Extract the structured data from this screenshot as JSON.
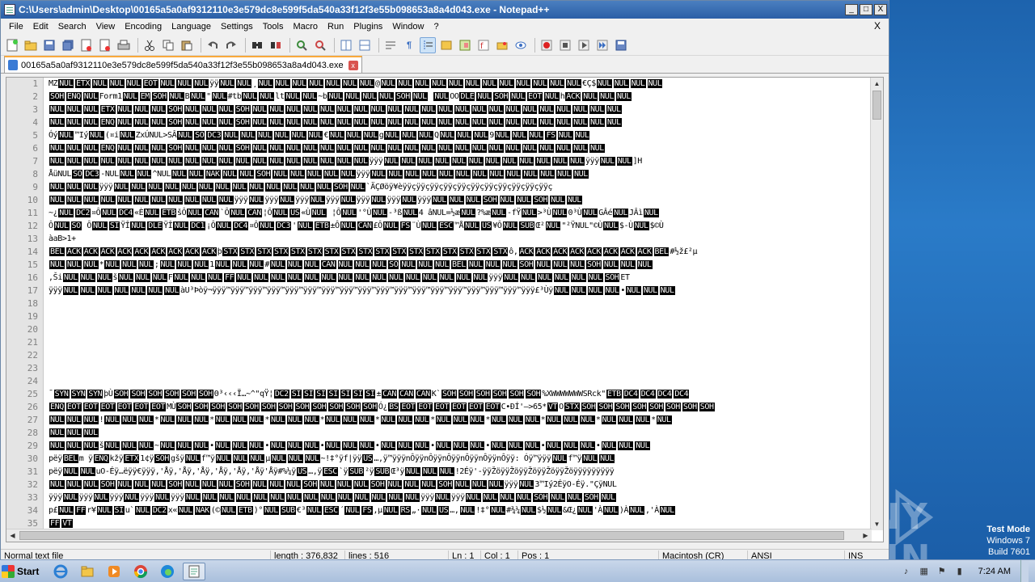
{
  "window": {
    "title": "C:\\Users\\admin\\Desktop\\00165a5a0af9312110e3e579dc8e599f5da540a33f12f3e55b098653a8a4d043.exe - Notepad++",
    "minimize": "_",
    "maximize": "□",
    "close": "X"
  },
  "menu": {
    "items": [
      "File",
      "Edit",
      "Search",
      "View",
      "Encoding",
      "Language",
      "Settings",
      "Tools",
      "Macro",
      "Run",
      "Plugins",
      "Window",
      "?"
    ],
    "close_doc": "X"
  },
  "tab": {
    "label": "00165a5a0af9312110e3e579dc8e599f5da540a33f12f3e55b098653a8a4d043.exe",
    "close": "x"
  },
  "editor": {
    "line_numbers": [
      "1",
      "2",
      "3",
      "4",
      "5",
      "6",
      "7",
      "8",
      "9",
      "10",
      "11",
      "12",
      "13",
      "14",
      "15",
      "16",
      "17",
      "18",
      "19",
      "20",
      "21",
      "22",
      "23",
      "24",
      "25",
      "26",
      "27",
      "28",
      "29",
      "30",
      "31",
      "32",
      "33",
      "34",
      "35"
    ],
    "lines": [
      [
        "MZ",
        "NUL",
        "ETX",
        "NUL",
        "NUL",
        "NUL",
        "EOT",
        "NUL",
        "NUL",
        "NUL",
        "ÿÿ",
        "NUL",
        "NUL",
        "¸",
        "NUL",
        "NUL",
        "NUL",
        "NUL",
        "NUL",
        "NUL",
        "NUL",
        "@",
        "NUL",
        "NUL",
        "NUL",
        "NUL",
        "NUL",
        "NUL",
        "NUL",
        "NUL",
        "NUL",
        "NUL",
        "NUL",
        "NUL",
        "€Ç$",
        "NUL",
        "NUL",
        "NUL",
        "NUL"
      ],
      [
        "SOH",
        "ENQ",
        "NUL",
        "Form1",
        "NUL",
        "EM",
        "SOH",
        "NUL",
        "B",
        "NUL",
        "\"",
        "NUL",
        "#tb",
        "NUL",
        "NUL",
        "lt",
        "NUL",
        "NUL",
        "~b",
        "NUL",
        "NUL",
        "NUL",
        "NUL",
        "SOH",
        "NUL",
        "   ",
        "NUL",
        "OO",
        "DLE",
        "NUL",
        "SOH",
        "NUL",
        "EOT",
        "NUL",
        "h",
        "ACK",
        "NUL",
        "NUL",
        "NUL"
      ],
      [
        "NUL",
        "NUL",
        "NUL",
        "ETX",
        "NUL",
        "NUL",
        "NUL",
        "SOH",
        "NUL",
        "NUL",
        "NUL",
        "SOH",
        "NUL",
        "NUL",
        "NUL",
        "NUL",
        "NUL",
        "NUL",
        "NUL",
        "NUL",
        "NUL",
        "NUL",
        "NUL",
        "NUL",
        "NUL",
        "NUL",
        "NUL",
        "NUL",
        "NUL",
        "NUL",
        "NUL",
        "NUL",
        "NUL",
        "NUL"
      ],
      [
        "NUL",
        "NUL",
        "NUL",
        "ENQ",
        "NUL",
        "NUL",
        "NUL",
        "SOH",
        "NUL",
        "NUL",
        "NUL",
        "SOH",
        "NUL",
        "NUL",
        "NUL",
        "NUL",
        "NUL",
        "NUL",
        "NUL",
        "NUL",
        "NUL",
        "NUL",
        "NUL",
        "NUL",
        "NUL",
        "NUL",
        "NUL",
        "NUL",
        "NUL",
        "NUL",
        "NUL",
        "NUL",
        "NUL",
        "NUL"
      ],
      [
        " Óý",
        "NUL",
        "™Iý",
        "NUL",
        "(¤i",
        "NUL",
        "Zx",
        "ÚNUL",
        ">SÂ",
        "NUL",
        "SO",
        "DC3",
        "NUL",
        "NUL",
        "NUL",
        "NUL",
        "NUL",
        "NUL",
        "€",
        "NUL",
        "NUL",
        "NUL",
        "g",
        "NUL",
        "NUL",
        "NUL",
        "Q",
        "NUL",
        "NUL",
        "NUL",
        "9",
        "NUL",
        "NUL",
        "NUL",
        "FS",
        "NUL",
        "NUL"
      ],
      [
        "NUL",
        "NUL",
        "NUL",
        "ENQ",
        "NUL",
        "NUL",
        "NUL",
        "SOH",
        "NUL",
        "NUL",
        "NUL",
        "SOH",
        "NUL",
        "NUL",
        "NUL",
        "NUL",
        "NUL",
        "NUL",
        "NUL",
        "NUL",
        "NUL",
        "NUL",
        "NUL",
        "NUL",
        "NUL",
        "NUL",
        "NUL",
        "NUL",
        "NUL",
        "NUL",
        "NUL",
        "NUL",
        "NUL"
      ],
      [
        "NUL",
        "NUL",
        "NUL",
        "NUL",
        "NUL",
        "NUL",
        "NUL",
        "NUL",
        "NUL",
        "NUL",
        "NUL",
        "NUL",
        "NUL",
        "NUL",
        "NUL",
        "NUL",
        "NUL",
        "NUL",
        "NUL",
        "ÿÿÿ",
        "NUL",
        "NUL",
        "NUL",
        "NUL",
        "NUL",
        "NUL",
        "NUL",
        "NUL",
        "NUL",
        "NUL",
        "NUL",
        "NUL",
        "ÿÿÿ",
        "NUL",
        "NUL",
        "]H"
      ],
      [
        "ÅüNUL",
        "SO",
        "DC3",
        "-NUL",
        "NUL",
        "NUL",
        "^NUL",
        "NUL",
        "NUL",
        "NAK",
        "NUL",
        "NUL",
        "SOH",
        "NUL",
        "NUL",
        "NUL",
        "NUL",
        "NUL",
        "ÿÿÿ",
        "NUL",
        "NUL",
        "NUL",
        "NUL",
        "NUL",
        "NUL",
        "NUL",
        "NUL",
        "NUL",
        "NUL",
        "NUL",
        "NUL",
        "NUL"
      ],
      [
        "NUL",
        "NUL",
        "NUL",
        "ÿÿÿ",
        "NUL",
        "NUL",
        "NUL",
        "NUL",
        "NUL",
        "NUL",
        "NUL",
        "NUL",
        "NUL",
        "NUL",
        "NUL",
        "NUL",
        "NUL",
        "SOH",
        "NUL",
        "`ÄÇØöÿ¥èÿÿçÿÿçÿÿçÿÿçÿÿçÿÿçÿÿçÿÿçÿÿçÿÿçÿÿç"
      ],
      [
        "NUL",
        "NUL",
        "NUL",
        "NUL",
        "NUL",
        "NUL",
        "NUL",
        "NUL",
        "NUL",
        "NUL",
        "NUL",
        "ÿÿÿ",
        "NUL",
        "ÿÿÿ",
        "NUL",
        "ÿÿÿ",
        "NUL",
        "ÿÿÿ",
        "NUL",
        "ÿÿÿ",
        "NUL",
        "ÿÿÿ",
        "NUL",
        "ÿÿÿ",
        "NUL",
        "NUL",
        "NUL",
        "SOH",
        "NUL",
        "NUL",
        "SOH",
        "NUL",
        "NUL"
      ],
      [
        "~¿",
        "NUL",
        "DC2",
        "¤Ô",
        "NUL",
        "DC4",
        "«È",
        "NUL",
        "ETB",
        "šÔ",
        "NUL",
        "CAN",
        "`Ô",
        "NUL",
        "CAN",
        "¦Ô",
        "NUL",
        "US",
        "«Ù",
        "NUL",
        " ¦Ô",
        "NUL",
        "'°Ù",
        "NUL",
        "-³ß",
        "NUL",
        "4 âNUL",
        "=½æ",
        "NUL",
        "?%æ",
        "NUL",
        "-fŸ",
        "NUL",
        ">³Ù",
        "NUL",
        "0³Ù",
        "NUL",
        "GÂé",
        "NUL",
        "JÂì",
        "NUL"
      ],
      [
        " Ô",
        "NUL",
        "SO",
        " Ô",
        "NUL",
        "SI",
        "ŸÎ",
        "NUL",
        "DLE",
        "ŸÎ",
        "NUL",
        "DC1",
        "¡Ô",
        "NUL",
        "DC4",
        "¤Ô",
        "NUL",
        "DC3",
        "'",
        "NUL",
        "ETB",
        "±Ô",
        "NUL",
        "CAN",
        "£Ô",
        "NUL",
        "FS",
        "¨Ù",
        "NUL",
        "ESC",
        "™Å",
        "NUL",
        "US",
        "¥Ô",
        "NUL",
        "SUB",
        "Œ²",
        "NUL",
        "\"²",
        "ŸNUL",
        "\"©Ù",
        "NUL",
        "$-Ù",
        "NUL",
        "$©Ù"
      ],
      [
        "àaB>1+"
      ],
      [
        "BEL",
        "ACK",
        "ACK",
        "ACK",
        "ACK",
        "ACK",
        "ACK",
        "ACK",
        "ACK",
        "ACK",
        "þ",
        "STX",
        "STX",
        "STX",
        "STX",
        "STX",
        "STX",
        "STX",
        "STX",
        "STX",
        "STX",
        "STX",
        "STX",
        "STX",
        "STX",
        "STX",
        "STX",
        "STX",
        "ô,",
        "ACK",
        "ACK",
        "ACK",
        "ACK",
        "ACK",
        "ACK",
        "ACK",
        "ACK",
        "BEL",
        "#½ž£²µ"
      ],
      [
        "NUL",
        "NUL",
        "NUL",
        "*",
        "NUL",
        "NUL",
        "NUL",
        ";",
        "NUL",
        "NUL",
        "NUL",
        "1",
        "NUL",
        "NUL",
        "NUL",
        "#",
        "NUL",
        "NUL",
        "NUL",
        "CAN",
        "NUL",
        "NUL",
        "NUL",
        "SO",
        "NUL",
        "NUL",
        "NUL",
        "BEL",
        "NUL",
        "NUL",
        "NUL",
        "SOH",
        "NUL",
        "NUL",
        "NUL",
        "SOH",
        "NUL",
        "NUL",
        "NUL"
      ],
      [
        ",Ši",
        "NUL",
        "NUL",
        "NUL",
        "š",
        "NUL",
        "NUL",
        "NUL",
        "F",
        "NUL",
        "NUL",
        "NUL",
        "FF",
        "NUL",
        "NUL",
        "NUL",
        "NUL",
        "NUL",
        "NUL",
        "NUL",
        "NUL",
        "NUL",
        "NUL",
        "NUL",
        "NUL",
        "NUL",
        "NUL",
        "NUL",
        "ÿÿÿ",
        "NUL",
        "NUL",
        "NUL",
        "NUL",
        "NUL",
        "NUL",
        "SOH",
        "ET"
      ],
      [
        "ÿÿÿ",
        "NUL",
        "NUL",
        "NUL",
        "NUL",
        "NUL",
        "NUL",
        "NUL",
        "àU³Þòÿ¬ÿÿÿ™ÿÿÿ™ÿÿÿ™ÿÿÿ™ÿÿÿ™ÿÿÿ™ÿÿÿ™ÿÿÿ™ÿÿÿ™ÿÿÿ™ÿÿÿ™ÿÿÿ™ÿÿÿ™ÿÿÿ™ÿÿÿ™ÿÿÿ™ÿÿÿ™ÿÿÿ£³Ùÿ",
        "NUL",
        "NUL",
        "NUL",
        "NUL",
        "•",
        "NUL",
        "NUL",
        "NUL"
      ],
      [],
      [],
      [],
      [],
      [],
      [],
      [],
      [
        "¯",
        "SYN",
        "SYN",
        "SYN",
        "þÙ",
        "SOH",
        "SOH",
        "SOH",
        "SOH",
        "SOH",
        "SOH",
        "Θ³‹‹‹Ï…~^\"qŸ¦",
        "DC2",
        "SI",
        "SI",
        "SI",
        "SI",
        "SI",
        "SI",
        "SI",
        "±",
        "CAN",
        "CAN",
        "CAN",
        "K`",
        "SOH",
        "SOH",
        "SOH",
        "SOH",
        "SOH",
        "SOH",
        "%XWWWWWWWSRck\"",
        "ETB",
        "DC4",
        "DC4",
        "DC4",
        "DC4"
      ],
      [
        "ENQ",
        "EOT",
        "EOT",
        "EOT",
        "EOT",
        "EOT",
        "EOT",
        "MÙ",
        "SOH",
        "SOH",
        "SOH",
        "SOH",
        "SOH",
        "SOH",
        "SOH",
        "SOH",
        "SOH",
        "SOH",
        "SOH",
        "SOH",
        "Ó¿",
        "BS",
        "EOT",
        "EOT",
        "EOT",
        "EOT",
        "EOT",
        "EOT",
        "C•ÐÍ'–>65*",
        "VT",
        "O",
        "STX",
        "SOH",
        "SOH",
        "SOH",
        "SOH",
        "SOH",
        "SOH",
        "SOH",
        "SOH"
      ],
      [
        "NUL",
        "NUL",
        "NUL",
        "!",
        "NUL",
        "NUL",
        "NUL",
        "*",
        "NUL",
        "NUL",
        "NUL",
        "*",
        "NUL",
        "NUL",
        "NUL",
        "*",
        "NUL",
        "NUL",
        "NUL",
        "*",
        "NUL",
        "NUL",
        "NUL",
        "*",
        "NUL",
        "NUL",
        "NUL",
        "*",
        "NUL",
        "NUL",
        "NUL",
        "*",
        "NUL",
        "NUL",
        "NUL",
        "*",
        "NUL",
        "NUL",
        "NUL",
        "*",
        "NUL",
        "NUL",
        "NUL",
        "*",
        "NUL"
      ],
      [
        "NUL",
        "NUL",
        "NUL"
      ],
      [
        "NUL",
        "NUL",
        "NUL",
        "š",
        "NUL",
        "NUL",
        "NUL",
        "~",
        "NUL",
        "NUL",
        "NUL",
        "•",
        "NUL",
        "NUL",
        "NUL",
        "•",
        "NUL",
        "NUL",
        "NUL",
        "•",
        "NUL",
        "NUL",
        "NUL",
        "•",
        "NUL",
        "NUL",
        "NUL",
        "•",
        "NUL",
        "NUL",
        "NUL",
        "•",
        "NUL",
        "NUL",
        "NUL",
        "•",
        "NUL",
        "NUL",
        "NUL",
        "•",
        "NUL",
        "NUL",
        "NUL"
      ],
      [
        "pëÿ",
        "BEL",
        "m ÿ",
        "ENQ",
        "kžÿ",
        "ETX",
        "1¢ÿ",
        "SOH",
        "gšÿ",
        "NUL",
        "f™ÿ",
        "NUL",
        "NUL",
        "NUL",
        "µ",
        "NUL",
        "NUL",
        "NUL",
        "~!‡°ÿf|ÿÿ",
        "US",
        "…,ÿ™ÿÿÿnÔÿÿnÔÿÿnÔÿÿnÔÿÿnÔÿÿnÔÿÿ: Óÿ™ÿÿÿ",
        "NUL",
        "f™ÿ",
        "NUL",
        "NUL"
      ],
      [
        "pëÿ",
        "NUL",
        "NUL",
        "uO-Éÿ…ëÿÿ€ÿÿÿ,'Åÿ,'Åÿ,'Åÿ,'Åÿ,'Åÿ,'Åÿ'Åÿ#%¼ÿ",
        "US",
        "…,ÿ",
        "ESC",
        "`ÿ",
        "SUB",
        "²ÿ",
        "SUB",
        "Œ³ÿ",
        "NUL",
        "NUL",
        "NUL",
        "!2Éÿ'-ÿÿŽöÿÿŽöÿÿŽöÿÿŽöÿÿŽöÿÿÿÿÿÿÿÿÿ"
      ],
      [
        "NUL",
        "NUL",
        "NUL",
        "SOH",
        "NUL",
        "NUL",
        "NUL",
        "SOH",
        "NUL",
        "NUL",
        "NUL",
        "SOH",
        "NUL",
        "NUL",
        "NUL",
        "SOH",
        "NUL",
        "NUL",
        "NUL",
        "SOH",
        "NUL",
        "NUL",
        "NUL",
        "SOH",
        "NUL",
        "NUL",
        "NUL",
        "ÿÿÿ",
        "NUL",
        "3™Iý2ÉÿO-Éÿ.\"ÇÿNUL"
      ],
      [
        "ÿÿÿ",
        "NUL",
        "ÿÿÿ",
        "NUL",
        "ÿÿÿ",
        "NUL",
        "ÿÿÿ",
        "NUL",
        "ÿÿÿ",
        "NUL",
        "NUL",
        "NUL",
        "NUL",
        "NUL",
        "NUL",
        "NUL",
        "NUL",
        "NUL",
        "NUL",
        "NUL",
        "NUL",
        "NUL",
        "NUL",
        "ÿÿÿ",
        "NUL",
        "ÿÿÿ",
        "NUL",
        "NUL",
        "NUL",
        "NUL",
        "SOH",
        "NUL",
        "NUL",
        "SOH",
        "NUL"
      ],
      [
        "p£",
        "NUL",
        "FF",
        "r¥",
        "NUL",
        "SI",
        "u`",
        "NUL",
        "DC2",
        "x«",
        "NUL",
        "NAK",
        "(©",
        "NUL",
        "ETB",
        ")°",
        "NUL",
        "SUB",
        "€³",
        "NUL",
        "ESC",
        "´",
        "NUL",
        "FS",
        ",µ",
        "NUL",
        "RS",
        "„·",
        "NUL",
        "US",
        "…,",
        "NUL",
        "!‡°",
        "NUL",
        "#¾¼",
        "NUL",
        "$½",
        "NUL",
        "&Œ¿",
        "NUL",
        "'À",
        "NUL",
        ")À",
        "NUL",
        ",'À",
        "NUL"
      ],
      [
        "FF",
        "VT"
      ]
    ]
  },
  "status": {
    "type": "Normal text file",
    "length": "length : 376,832",
    "lines": "lines : 516",
    "ln": "Ln : 1",
    "col": "Col : 1",
    "pos": "Pos : 1",
    "eol": "Macintosh (CR)",
    "encoding": "ANSI",
    "mode": "INS"
  },
  "desktop": {
    "watermark": "ANY RUN",
    "test_mode_line1": "Test Mode",
    "test_mode_line2": "Windows 7",
    "test_mode_line3": "Build 7601"
  },
  "taskbar": {
    "start_label": "Start",
    "clock": "7:24 AM",
    "apps": [
      "ie-icon",
      "explorer-icon",
      "media-player-icon",
      "chrome-icon",
      "edge-icon",
      "notepadpp-icon"
    ]
  }
}
